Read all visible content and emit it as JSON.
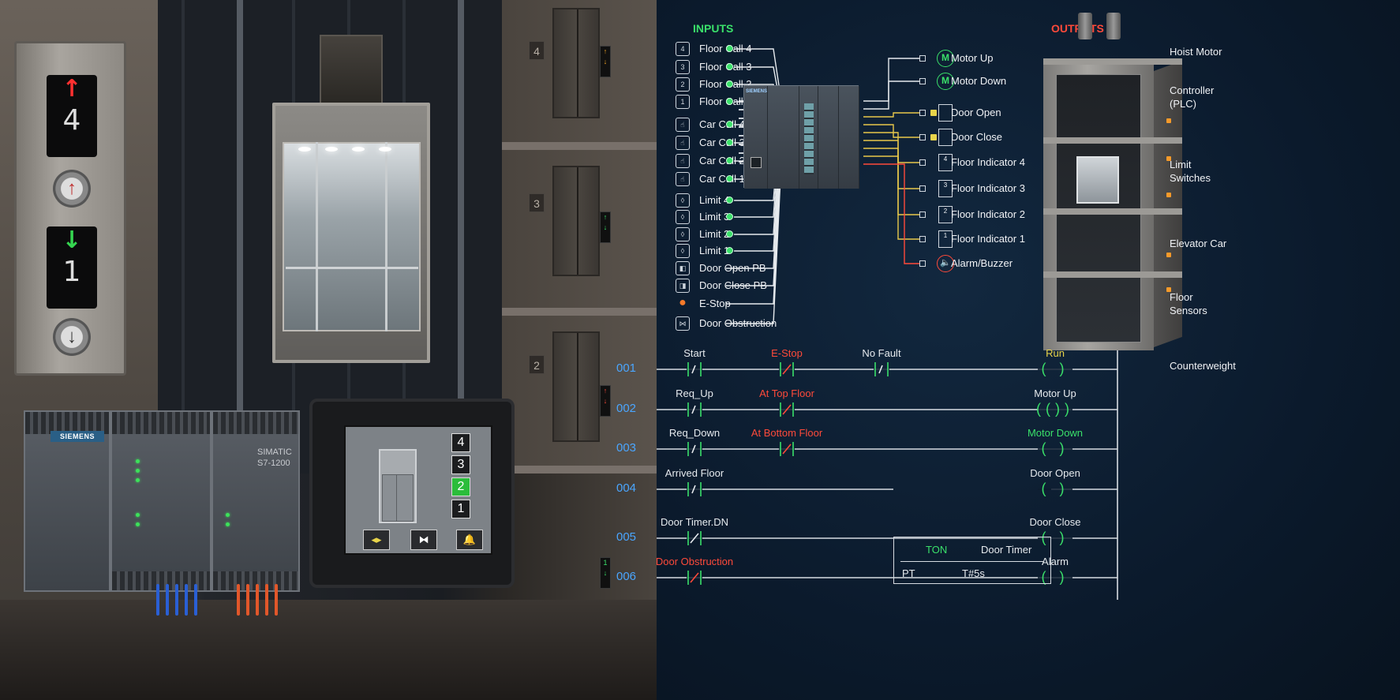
{
  "hall_panel": {
    "upper_display": {
      "arrow": "↑",
      "floor": "4"
    },
    "lower_display": {
      "arrow": "↓",
      "floor": "1"
    },
    "up_button": "↑",
    "down_button": "↓"
  },
  "hall_floor_numbers": [
    "4",
    "3",
    "2"
  ],
  "plc_hardware": {
    "brand": "SIEMENS",
    "model_line1": "SIMATIC",
    "model_line2": "S7-1200"
  },
  "hmi": {
    "floors": [
      "4",
      "3",
      "2",
      "1"
    ],
    "active_floor": "2",
    "buttons": [
      "◂▸",
      "⧓",
      "🔔"
    ]
  },
  "io_diagram": {
    "inputs_title": "INPUTS",
    "outputs_title": "OUTPUTS",
    "inputs": [
      {
        "label": "Floor Call 4",
        "icon": "4",
        "dot": true
      },
      {
        "label": "Floor Call 3",
        "icon": "3",
        "dot": true
      },
      {
        "label": "Floor Call 2",
        "icon": "2",
        "dot": true
      },
      {
        "label": "Floor Call 1",
        "icon": "1",
        "dot": true
      },
      {
        "label": "Car Call 4",
        "icon": "☝",
        "dot": true
      },
      {
        "label": "Car Call 3",
        "icon": "☝",
        "dot": true
      },
      {
        "label": "Car Call 2",
        "icon": "☝",
        "dot": true
      },
      {
        "label": "Car Call 1",
        "icon": "☝",
        "dot": true
      },
      {
        "label": "Limit 4",
        "icon": "◊",
        "dot": true
      },
      {
        "label": "Limit 3",
        "icon": "◊",
        "dot": true
      },
      {
        "label": "Limit 2",
        "icon": "◊",
        "dot": true
      },
      {
        "label": "Limit 1",
        "icon": "◊",
        "dot": true
      },
      {
        "label": "Door Open PB",
        "icon": "◧",
        "dot": false
      },
      {
        "label": "Door Close PB",
        "icon": "◨",
        "dot": false
      },
      {
        "label": "E-Stop",
        "icon": "●",
        "dot": false
      },
      {
        "label": "Door Obstruction",
        "icon": "⋈",
        "dot": false
      }
    ],
    "outputs": [
      {
        "label": "Motor Up",
        "kind": "motor",
        "icon": "M"
      },
      {
        "label": "Motor Down",
        "kind": "motor",
        "icon": "M"
      },
      {
        "label": "Door Open",
        "kind": "door",
        "icon": ""
      },
      {
        "label": "Door Close",
        "kind": "door",
        "icon": ""
      },
      {
        "label": "Floor Indicator 4",
        "kind": "floor",
        "icon": "4"
      },
      {
        "label": "Floor Indicator 3",
        "kind": "floor",
        "icon": "3"
      },
      {
        "label": "Floor Indicator 2",
        "kind": "floor",
        "icon": "2"
      },
      {
        "label": "Floor Indicator 1",
        "kind": "floor",
        "icon": "1"
      },
      {
        "label": "Alarm/Buzzer",
        "kind": "alarm",
        "icon": "🔈"
      }
    ],
    "plc_brand": "SIEMENS",
    "callouts": {
      "hoist_motor": "Hoist Motor",
      "controller_1": "Controller",
      "controller_2": "(PLC)",
      "limit_1": "Limit",
      "limit_2": "Switches",
      "elevator_car": "Elevator Car",
      "floor_sensors_1": "Floor",
      "floor_sensors_2": "Sensors",
      "counterweight": "Counterweight"
    }
  },
  "ladder": {
    "rungs": [
      {
        "num": "001",
        "contacts": [
          {
            "label": "Start",
            "type": "NO",
            "color": "white"
          },
          {
            "label": "E-Stop",
            "type": "NC",
            "color": "red"
          },
          {
            "label": "No Fault",
            "type": "NO",
            "color": "white"
          }
        ],
        "coil": {
          "label": "Run",
          "color": "yellow",
          "style": "( )"
        }
      },
      {
        "num": "002",
        "contacts": [
          {
            "label": "Req_Up",
            "type": "NO",
            "color": "white"
          },
          {
            "label": "At Top Floor",
            "type": "NC",
            "color": "red"
          }
        ],
        "coil": {
          "label": "Motor Up",
          "color": "white",
          "style": "(())"
        }
      },
      {
        "num": "003",
        "contacts": [
          {
            "label": "Req_Down",
            "type": "NO",
            "color": "white"
          },
          {
            "label": "At Bottom Floor",
            "type": "NC",
            "color": "red"
          }
        ],
        "coil": {
          "label": "Motor Down",
          "color": "green",
          "style": "( )"
        }
      },
      {
        "num": "004",
        "contacts": [
          {
            "label": "Arrived Floor",
            "type": "NO",
            "color": "white"
          }
        ],
        "coil": {
          "label": "Door Open",
          "color": "white",
          "style": "( )"
        }
      },
      {
        "num": "005",
        "contacts": [
          {
            "label": "Door Timer.DN",
            "type": "NC",
            "color": "white"
          }
        ],
        "coil": {
          "label": "Door Close",
          "color": "white",
          "style": "( )"
        }
      },
      {
        "num": "006",
        "contacts": [
          {
            "label": "Door Obstruction",
            "type": "NC",
            "color": "red"
          }
        ],
        "coil": {
          "label": "Alarm",
          "color": "white",
          "style": "( )"
        }
      }
    ],
    "timer": {
      "type": "TON",
      "name": "Door Timer",
      "pt_label": "PT",
      "pt_value": "T#5s"
    }
  },
  "colors": {
    "green": "#3ae06a",
    "red": "#ff4a3a",
    "yellow": "#e8d44a",
    "white": "#e6eaee",
    "blue_num": "#4aa6ff",
    "wire_yellow": "#e8c84a",
    "wire_red": "#ff4a3a",
    "rail": "#d7dce2"
  }
}
